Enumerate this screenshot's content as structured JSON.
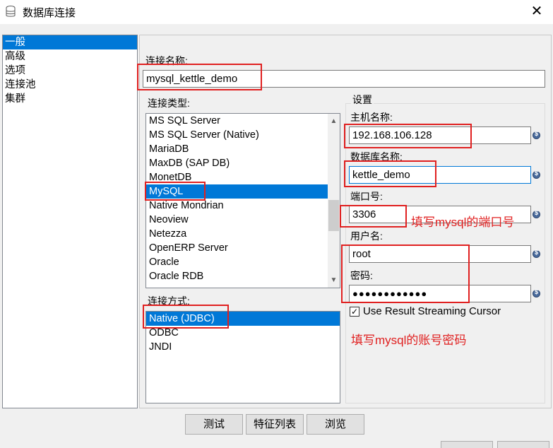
{
  "window": {
    "title": "数据库连接",
    "close_glyph": "✕"
  },
  "nav": {
    "items": [
      "一般",
      "高级",
      "选项",
      "连接池",
      "集群"
    ],
    "selected_index": 0
  },
  "connection_name": {
    "label": "连接名称:",
    "value": "mysql_kettle_demo"
  },
  "connection_type": {
    "label": "连接类型:",
    "items": [
      "MS SQL Server",
      "MS SQL Server (Native)",
      "MariaDB",
      "MaxDB (SAP DB)",
      "MonetDB",
      "MySQL",
      "Native Mondrian",
      "Neoview",
      "Netezza",
      "OpenERP Server",
      "Oracle",
      "Oracle RDB"
    ],
    "selected": "MySQL"
  },
  "access_method": {
    "label": "连接方式:",
    "items": [
      "Native (JDBC)",
      "ODBC",
      "JNDI"
    ],
    "selected": "Native (JDBC)"
  },
  "settings": {
    "title": "设置",
    "host_label": "主机名称:",
    "host_value": "192.168.106.128",
    "db_label": "数据库名称:",
    "db_value": "kettle_demo",
    "port_label": "端口号:",
    "port_value": "3306",
    "user_label": "用户名:",
    "user_value": "root",
    "password_label": "密码:",
    "password_value": "●●●●●●●●●●●●",
    "streaming_label": "Use Result Streaming Cursor",
    "streaming_checked": true
  },
  "annotations": {
    "port_note": "填写mysql的端口号",
    "account_note": "填写mysql的账号密码"
  },
  "buttons": {
    "test": "测试",
    "features": "特征列表",
    "explore": "浏览"
  },
  "colors": {
    "selection": "#0078d7",
    "annotation": "#e02020"
  }
}
